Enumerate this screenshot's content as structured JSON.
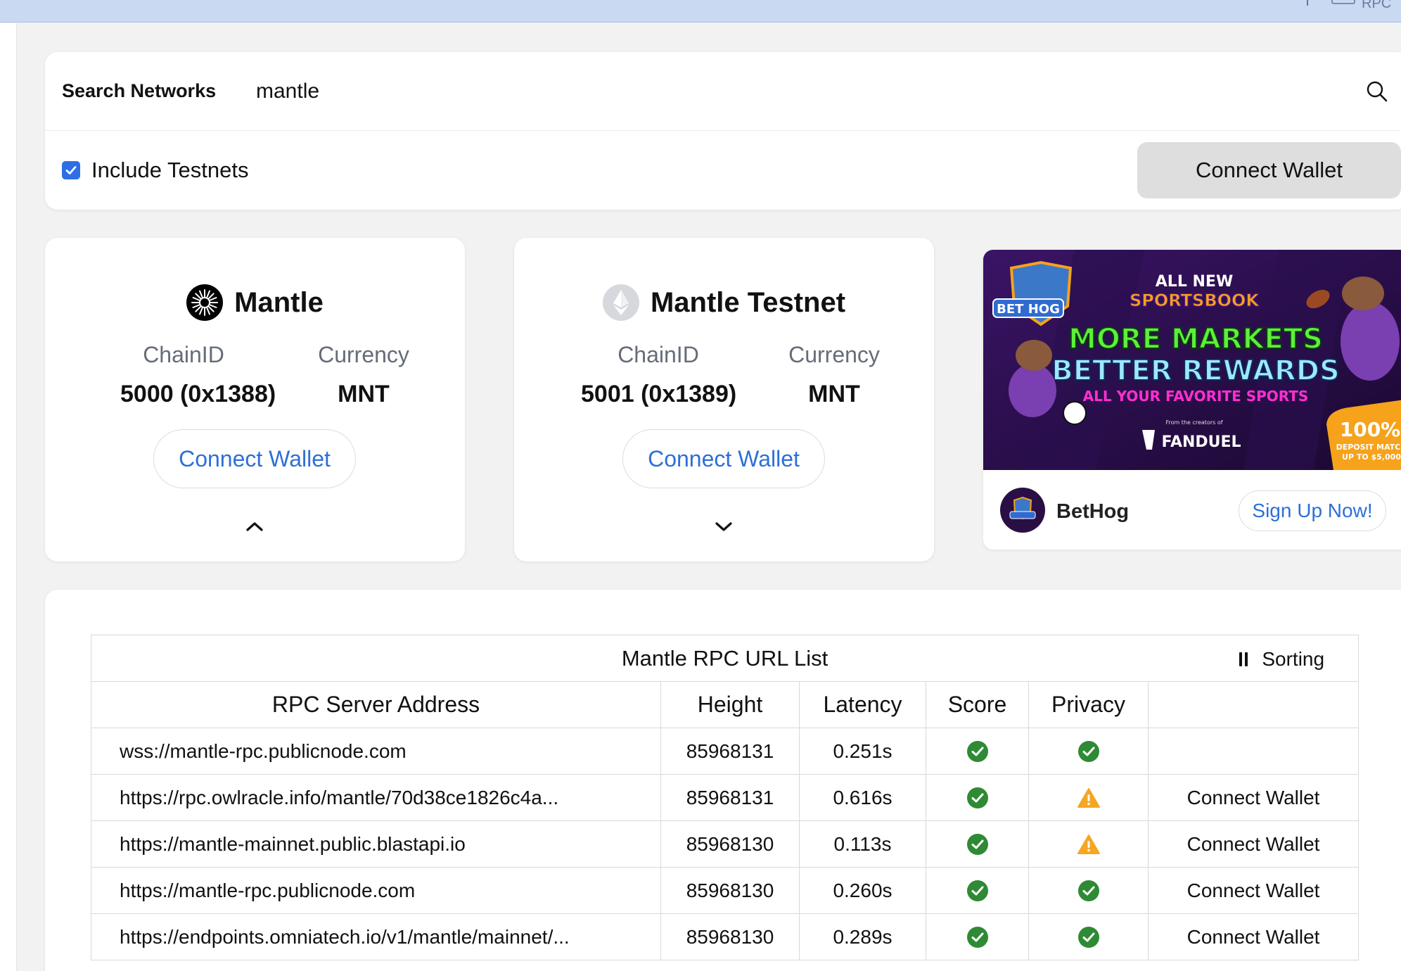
{
  "browser_bar": {
    "partial_text": "RPC"
  },
  "search": {
    "label": "Search Networks",
    "value": "mantle"
  },
  "testnets": {
    "label": "Include Testnets",
    "checked": true
  },
  "top_connect_label": "Connect Wallet",
  "networks": [
    {
      "name": "Mantle",
      "chain_id_label": "ChainID",
      "chain_id": "5000 (0x1388)",
      "currency_label": "Currency",
      "currency": "MNT",
      "connect_label": "Connect Wallet",
      "icon": "mantle-logo-icon",
      "expanded": true
    },
    {
      "name": "Mantle Testnet",
      "chain_id_label": "ChainID",
      "chain_id": "5001 (0x1389)",
      "currency_label": "Currency",
      "currency": "MNT",
      "connect_label": "Connect Wallet",
      "icon": "ethereum-logo-icon",
      "expanded": false
    }
  ],
  "ad": {
    "line1": "ALL NEW",
    "line2": "SPORTSBOOK",
    "line3": "MORE MARKETS",
    "line4": "BETTER REWARDS",
    "line5": "ALL YOUR FAVORITE SPORTS",
    "creators": "From the creators of",
    "fanduel": "FANDUEL",
    "badge_big": "100%",
    "badge_line1": "DEPOSIT MATCH",
    "badge_line2": "UP TO $5,000",
    "brand_logo_text": "BET HOG",
    "advertiser": "BetHog",
    "cta": "Sign Up Now!",
    "colors": {
      "purple": "#2a0f45",
      "green": "#5cf03a",
      "orange": "#f6a21b",
      "pink": "#ff2fd0"
    }
  },
  "rpc": {
    "title": "Mantle RPC URL List",
    "sorting_label": "Sorting",
    "headers": [
      "RPC Server Address",
      "Height",
      "Latency",
      "Score",
      "Privacy",
      ""
    ],
    "rows": [
      {
        "url": "wss://mantle-rpc.publicnode.com",
        "height": "85968131",
        "latency": "0.251s",
        "score": "ok",
        "privacy": "ok",
        "action": ""
      },
      {
        "url": "https://rpc.owlracle.info/mantle/70d38ce1826c4a...",
        "height": "85968131",
        "latency": "0.616s",
        "score": "ok",
        "privacy": "warning",
        "action": "Connect Wallet"
      },
      {
        "url": "https://mantle-mainnet.public.blastapi.io",
        "height": "85968130",
        "latency": "0.113s",
        "score": "ok",
        "privacy": "warning",
        "action": "Connect Wallet"
      },
      {
        "url": "https://mantle-rpc.publicnode.com",
        "height": "85968130",
        "latency": "0.260s",
        "score": "ok",
        "privacy": "ok",
        "action": "Connect Wallet"
      },
      {
        "url": "https://endpoints.omniatech.io/v1/mantle/mainnet/...",
        "height": "85968130",
        "latency": "0.289s",
        "score": "ok",
        "privacy": "ok",
        "action": "Connect Wallet"
      }
    ],
    "status_colors": {
      "ok": "#2e8a34",
      "warning": "#f5a623"
    }
  }
}
